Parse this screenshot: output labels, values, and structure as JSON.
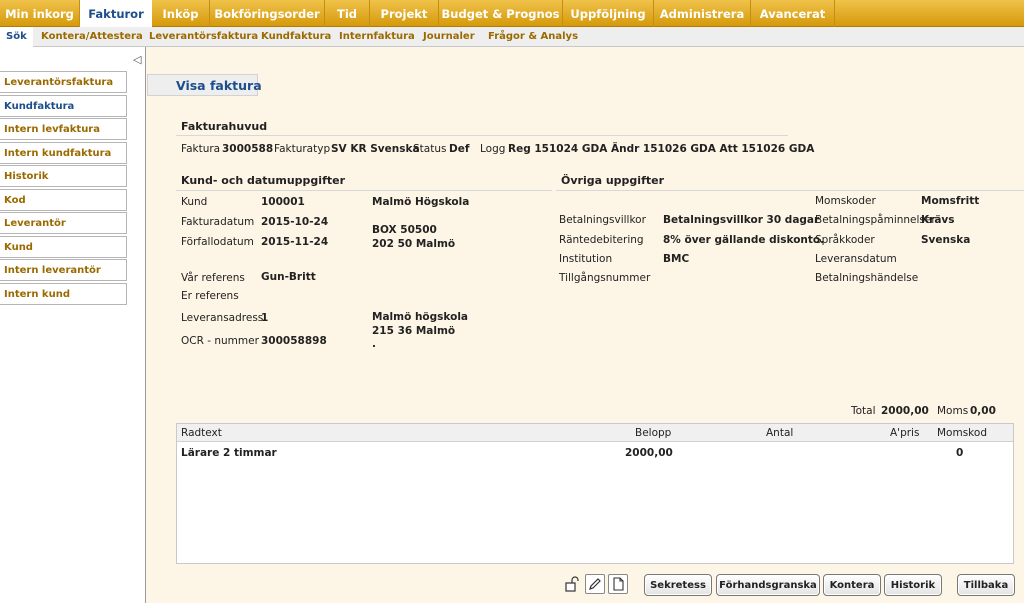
{
  "top_nav": [
    {
      "label": "Min inkorg"
    },
    {
      "label": "Fakturor"
    },
    {
      "label": "Inköp"
    },
    {
      "label": "Bokföringsorder"
    },
    {
      "label": "Tid"
    },
    {
      "label": "Projekt"
    },
    {
      "label": "Budget & Prognos"
    },
    {
      "label": "Uppföljning"
    },
    {
      "label": "Administrera"
    },
    {
      "label": "Avancerat"
    }
  ],
  "sub_nav": [
    {
      "label": "Sök"
    },
    {
      "label": "Kontera/Attestera"
    },
    {
      "label": "Leverantörsfaktura"
    },
    {
      "label": "Kundfaktura"
    },
    {
      "label": "Internfaktura"
    },
    {
      "label": "Journaler"
    },
    {
      "label": "Frågor & Analys"
    }
  ],
  "sidebar": {
    "collapse_icon": "triangle-left-icon",
    "items": [
      {
        "label": "Leverantörsfaktura"
      },
      {
        "label": "Kundfaktura"
      },
      {
        "label": "Intern levfaktura"
      },
      {
        "label": "Intern kundfaktura"
      },
      {
        "label": "Historik"
      },
      {
        "label": "Kod"
      },
      {
        "label": "Leverantör"
      },
      {
        "label": "Kund"
      },
      {
        "label": "Intern leverantör"
      },
      {
        "label": "Intern kund"
      }
    ]
  },
  "page_title": "Visa faktura",
  "fakturahuvud": {
    "heading": "Fakturahuvud",
    "faktura_label": "Faktura",
    "faktura_value": "3000588",
    "typ_label": "Fakturatyp",
    "typ_value": "SV KR Svenska",
    "status_label": "Status",
    "status_value": "Def",
    "logg_label": "Logg",
    "logg_value": "Reg 151024 GDA Ändr 151026 GDA Att 151026 GDA"
  },
  "kund": {
    "heading": "Kund- och datumuppgifter",
    "kund_label": "Kund",
    "kund_value": "100001",
    "kund_name": "Malmö Högskola",
    "fakturadatum_label": "Fakturadatum",
    "fakturadatum_value": "2015-10-24",
    "forfallodatum_label": "Förfallodatum",
    "forfallodatum_value": "2015-11-24",
    "address_line1": "BOX 50500",
    "address_line2": "202 50 Malmö",
    "var_ref_label": "Vår referens",
    "var_ref_value": "Gun-Britt",
    "er_ref_label": "Er referens",
    "leverans_label": "Leveransadress",
    "leverans_value": "1",
    "leverans_name": "Malmö högskola",
    "leverans_city": "215 36 Malmö",
    "leverans_extra": ".",
    "ocr_label": "OCR - nummer",
    "ocr_value": "300058898"
  },
  "ovriga": {
    "heading": "Övriga uppgifter",
    "betalningsvillkor_label": "Betalningsvillkor",
    "betalningsvillkor_value": "Betalningsvillkor 30 dagar",
    "rantedebitering_label": "Räntedebitering",
    "rantedebitering_value": "8% över gällande diskonto.",
    "institution_label": "Institution",
    "institution_value": "BMC",
    "tillgangsnummer_label": "Tillgångsnummer",
    "momskoder_label": "Momskoder",
    "momskoder_value": "Momsfritt",
    "paminnelser_label": "Betalningspåminnelser",
    "paminnelser_value": "Krävs",
    "sprakkoder_label": "Språkkoder",
    "sprakkoder_value": "Svenska",
    "leveransdatum_label": "Leveransdatum",
    "betalningshandelse_label": "Betalningshändelse"
  },
  "totals": {
    "total_label": "Total",
    "total_value": "2000,00",
    "moms_label": "Moms",
    "moms_value": "0,00"
  },
  "table": {
    "columns": {
      "radtext": "Radtext",
      "belopp": "Belopp",
      "antal": "Antal",
      "apris": "A'pris",
      "momskod": "Momskod"
    },
    "rows": [
      {
        "radtext": "Lärare 2 timmar",
        "belopp": "2000,00",
        "antal": "",
        "apris": "",
        "momskod": "0"
      }
    ]
  },
  "icons": {
    "lock": "unlock-icon",
    "edit": "pencil-icon",
    "doc": "document-icon"
  },
  "buttons": {
    "sekretess": "Sekretess",
    "forhandsgranska": "Förhandsgranska",
    "kontera": "Kontera",
    "historik": "Historik",
    "tillbaka": "Tillbaka"
  }
}
